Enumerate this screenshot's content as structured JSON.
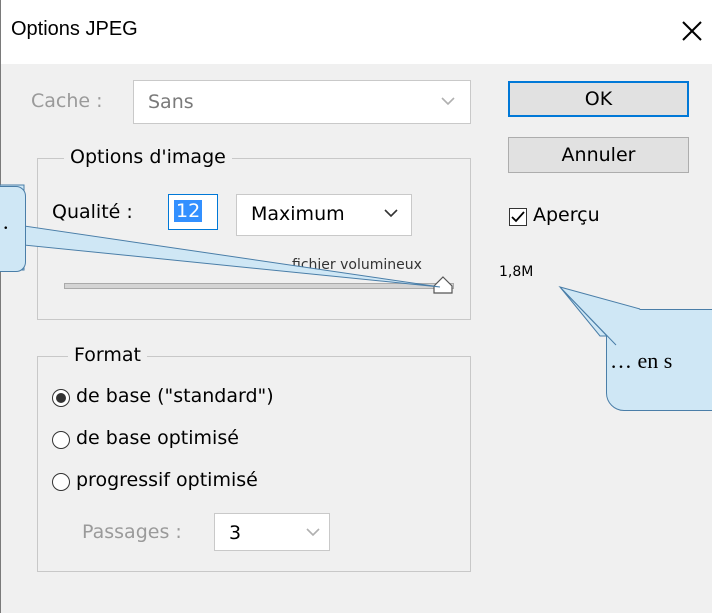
{
  "window": {
    "title": "Options JPEG"
  },
  "cache": {
    "label": "Cache :",
    "value": "Sans"
  },
  "image_options": {
    "title": "Options d'image",
    "quality_label": "Qualité :",
    "quality_value": "12",
    "quality_preset": "Maximum",
    "slider_right_label": "fichier volumineux",
    "quality_level_fraction": 1.0
  },
  "buttons": {
    "ok": "OK",
    "cancel": "Annuler"
  },
  "preview": {
    "label": "Aperçu",
    "checked": true,
    "file_size": "1,8M"
  },
  "format": {
    "title": "Format",
    "options": [
      {
        "label": "de base (\"standard\")",
        "selected": true
      },
      {
        "label": "de base optimisé",
        "selected": false
      },
      {
        "label": "progressif optimisé",
        "selected": false
      }
    ],
    "passes_label": "Passages :",
    "passes_value": "3"
  },
  "callouts": {
    "right_text": "… en s",
    "left_text": "."
  },
  "colors": {
    "dialog_bg": "#f0f0f0",
    "callout_fill": "#cfe7f5",
    "default_button_border": "#0078d7"
  }
}
